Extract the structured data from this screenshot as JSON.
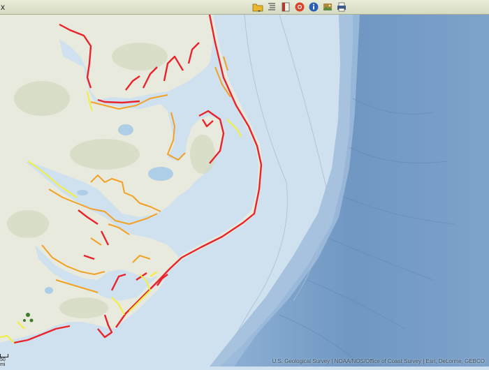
{
  "toolbar": {
    "close_glyph": "x",
    "buttons": [
      {
        "name": "folder-icon",
        "color": "#e8b830"
      },
      {
        "name": "layer-list-icon",
        "color": "#666666"
      },
      {
        "name": "bookmark-icon",
        "color": "#b23a30"
      },
      {
        "name": "record-icon",
        "color": "#d9432a"
      },
      {
        "name": "info-icon",
        "color": "#2a5fb5"
      },
      {
        "name": "basemap-gallery-icon",
        "color": "#b08a40"
      },
      {
        "name": "print-icon",
        "color": "#3a5a8c"
      }
    ]
  },
  "map": {
    "scale_label": "50 mi",
    "attribution": "U.S. Geological Survey | NOAA/NOS/Office of Coast Survey | Esri, DeLorme, GEBCO",
    "colors": {
      "land": "#e9ebdf",
      "shelf_water": "#c9dced",
      "deep_water": "#6f97c2",
      "vulnerability_very_high": "#e8232a",
      "vulnerability_high": "#f2a124",
      "vulnerability_moderate": "#f3ef3d"
    }
  }
}
